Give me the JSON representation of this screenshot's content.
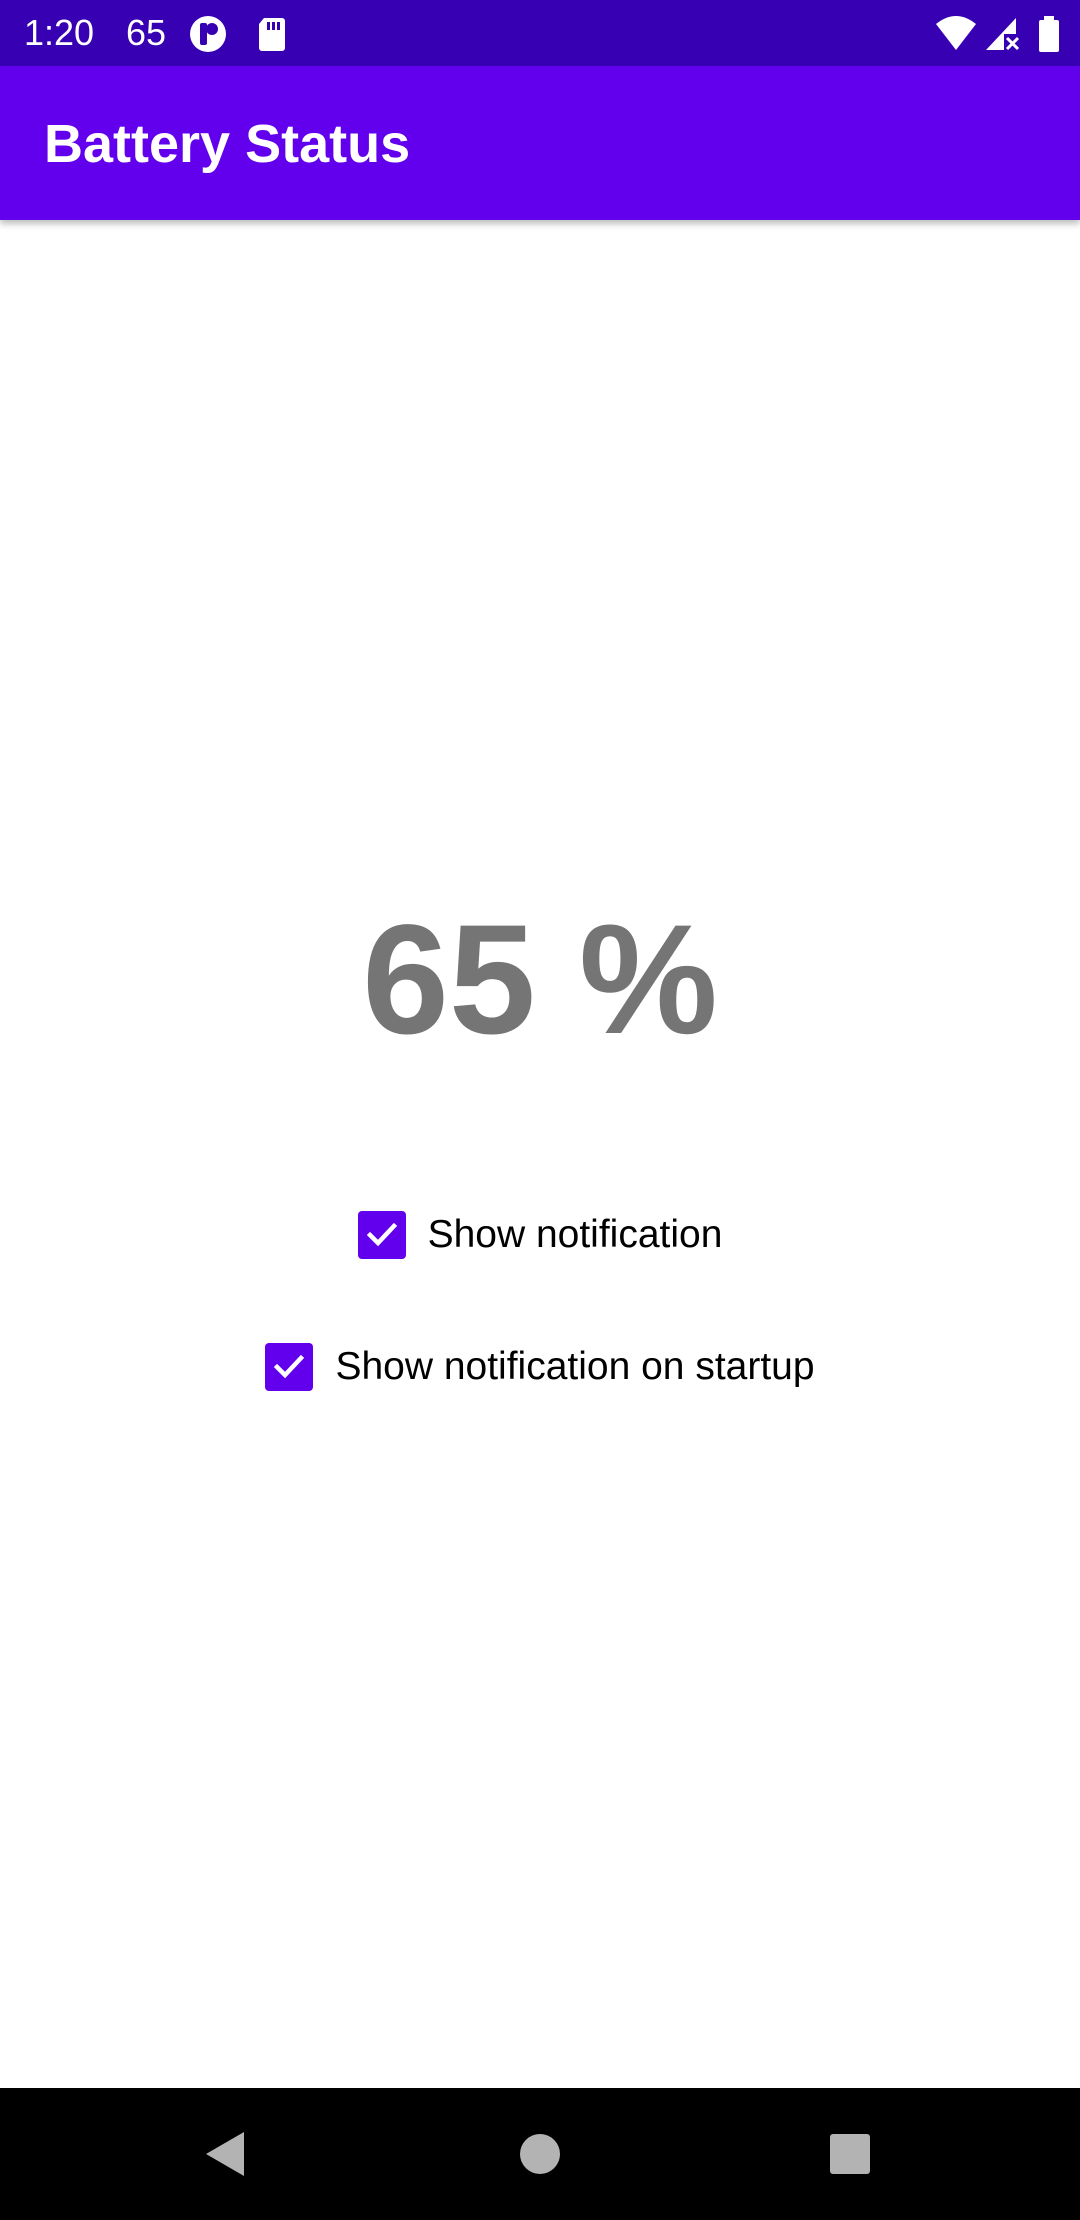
{
  "status_bar": {
    "time": "1:20",
    "battery_text": "65",
    "icons": [
      "app-notification-icon",
      "sd-card-icon",
      "wifi-icon",
      "cellular-signal-icon",
      "battery-icon"
    ]
  },
  "app_bar": {
    "title": "Battery Status"
  },
  "main": {
    "battery_percent": "65 %",
    "checkboxes": [
      {
        "label": "Show notification",
        "checked": true
      },
      {
        "label": "Show notification on startup",
        "checked": true
      }
    ]
  },
  "nav_bar": {
    "buttons": [
      "back-icon",
      "home-icon",
      "recents-icon"
    ]
  },
  "colors": {
    "status_bar": "#3700b3",
    "primary": "#6200ee",
    "percent_text": "#757575",
    "background": "#ffffff"
  }
}
